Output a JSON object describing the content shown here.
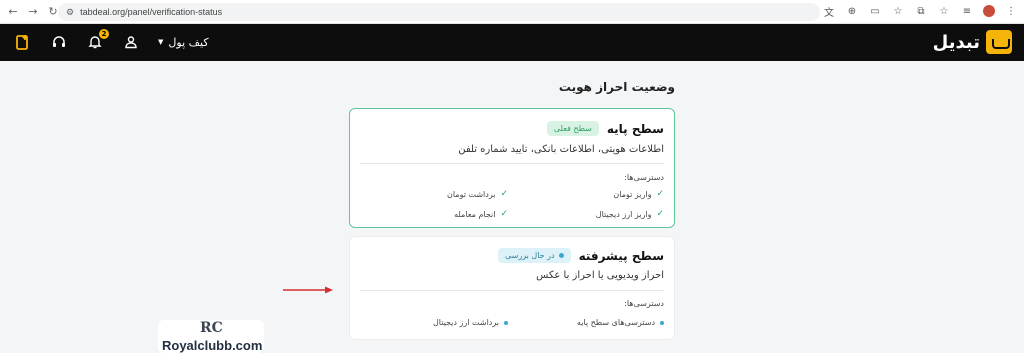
{
  "browser": {
    "url": "tabdeal.org/panel/verification-status"
  },
  "header": {
    "logo_text": "تبدیل",
    "wallet_label": "کیف پول",
    "notification_count": "2"
  },
  "page": {
    "title": "وضعیت احراز هویت"
  },
  "basic_level": {
    "title": "سطح پایه",
    "badge": "سطح فعلی",
    "description": "اطلاعات هویتی، اطلاعات بانکی، تایید شماره تلفن",
    "access_label": "دسترسی‌ها:",
    "access_items": [
      "واریز تومان",
      "برداشت تومان",
      "واریز ارز دیجیتال",
      "انجام معامله"
    ]
  },
  "advanced_level": {
    "title": "سطح پیشرفته",
    "badge": "در حال بررسی",
    "description": "احراز ویدیویی یا احراز با عکس",
    "access_label": "دسترسی‌ها:",
    "access_items": [
      "دسترسی‌های سطح پایه",
      "برداشت ارز دیجیتال"
    ]
  },
  "watermark": {
    "mark": "RC",
    "text": "Royalclubb.com"
  },
  "colors": {
    "brand_yellow": "#f5b40a",
    "header_bg": "#0d0d0d",
    "success_green": "#2f9d68",
    "review_blue": "#3aa8cf",
    "arrow_red": "#d32f2f"
  }
}
